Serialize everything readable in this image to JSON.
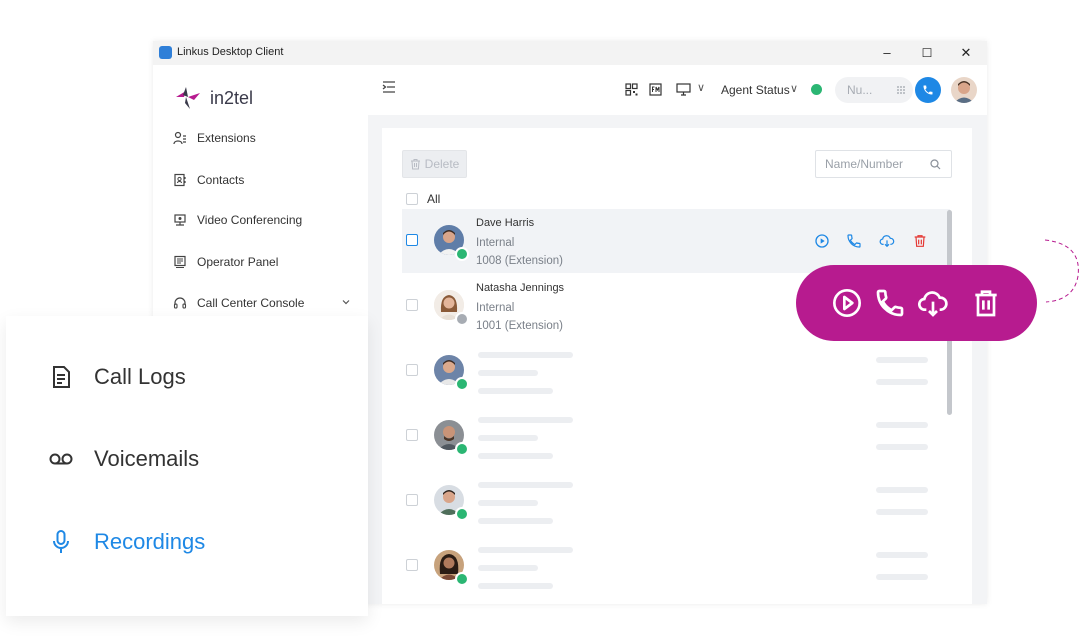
{
  "window": {
    "title": "Linkus Desktop Client",
    "minimize": "–",
    "maximize": "☐",
    "close": "✕"
  },
  "sidebar": {
    "logo_text": "in2tel",
    "items": [
      {
        "label": "Extensions",
        "icon": "person-list-icon"
      },
      {
        "label": "Contacts",
        "icon": "address-book-icon"
      },
      {
        "label": "Video Conferencing",
        "icon": "video-conference-icon"
      },
      {
        "label": "Operator Panel",
        "icon": "operator-panel-icon"
      },
      {
        "label": "Call Center Console",
        "icon": "headset-icon",
        "has_chevron": true
      }
    ]
  },
  "topbar": {
    "agent_status_label": "Agent Status",
    "agent_status_chevron": "∨",
    "dial_placeholder": "Nu...",
    "display_chevron": "∨"
  },
  "toolbar": {
    "delete_label": "Delete",
    "search_placeholder": "Name/Number",
    "select_all_label": "All"
  },
  "recordings": [
    {
      "name": "Dave Harris",
      "type": "Internal",
      "number": "1008 (Extension)",
      "status": "online",
      "selected_row": true
    },
    {
      "name": "Natasha Jennings",
      "type": "Internal",
      "number": "1001 (Extension)",
      "status": "offline"
    }
  ],
  "placeholder_rows": 4,
  "panel": {
    "items": [
      {
        "label": "Call Logs",
        "icon": "call-log-icon",
        "active": false
      },
      {
        "label": "Voicemails",
        "icon": "voicemail-icon",
        "active": false
      },
      {
        "label": "Recordings",
        "icon": "microphone-icon",
        "active": true
      }
    ]
  },
  "actions": [
    "play-icon",
    "phone-icon",
    "download-icon",
    "trash-icon"
  ],
  "colors": {
    "accent": "#1e88e5",
    "brand": "#b71b8f",
    "online": "#2bb673",
    "delete": "#e53935"
  }
}
